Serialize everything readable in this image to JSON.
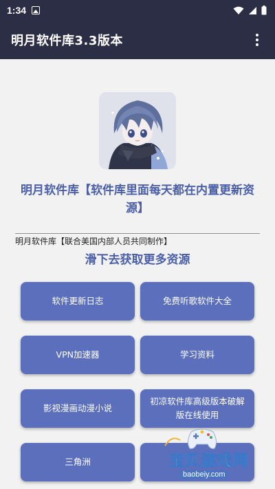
{
  "status_bar": {
    "time": "1:34"
  },
  "app_bar": {
    "title": "明月软件库3.3版本"
  },
  "main": {
    "headline": "明月软件库【软件库里面每天都在内置更新资源】",
    "subline": "明月软件库【联合美国内部人员共同制作】",
    "slide_hint": "滑下去获取更多资源",
    "buttons": [
      {
        "label": "软件更新日志"
      },
      {
        "label": "免费听歌软件大全"
      },
      {
        "label": "VPN加速器"
      },
      {
        "label": "学习资料"
      },
      {
        "label": "影视漫画动漫小说"
      },
      {
        "label": "初凉软件库高级版本破解版在线使用"
      },
      {
        "label": "三角洲"
      },
      {
        "label": ""
      }
    ]
  },
  "watermark": {
    "name": "宝贝游戏网",
    "url": "baobeiy.com"
  },
  "colors": {
    "toolbar": "#2b2e44",
    "accent_text": "#4a5fa8",
    "button": "#5b6fbd",
    "background": "#f2f2f3"
  },
  "icons": [
    "gallery-icon",
    "wifi-icon",
    "signal-icon",
    "battery-icon",
    "more-vert-icon",
    "gamepad-icon"
  ]
}
